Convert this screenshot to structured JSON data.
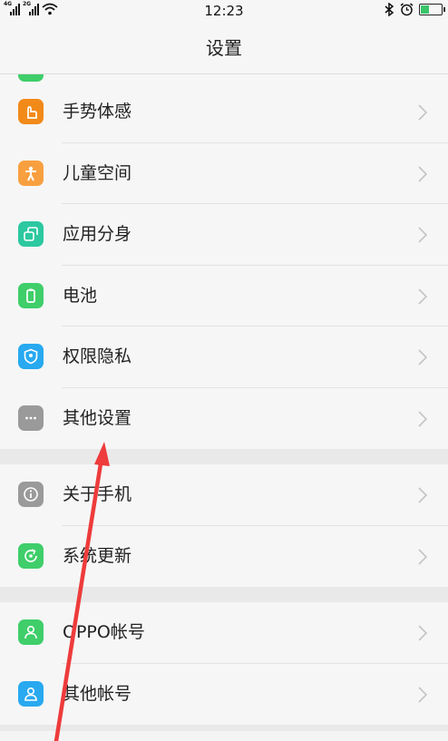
{
  "status": {
    "net1": "4G",
    "net2": "2G",
    "time": "12:23",
    "battery_level": 0.45
  },
  "header": {
    "title": "设置"
  },
  "groups": [
    [
      {
        "label": "手势体感",
        "icon": "gesture-icon",
        "color": "#f28a1a"
      },
      {
        "label": "儿童空间",
        "icon": "child-icon",
        "color": "#f8a040"
      },
      {
        "label": "应用分身",
        "icon": "app-clone-icon",
        "color": "#2cc8a0"
      },
      {
        "label": "电池",
        "icon": "battery-icon",
        "color": "#3fce6a"
      },
      {
        "label": "权限隐私",
        "icon": "shield-icon",
        "color": "#28a9f0"
      },
      {
        "label": "其他设置",
        "icon": "more-icon",
        "color": "#9a9a9a"
      }
    ],
    [
      {
        "label": "关于手机",
        "icon": "info-icon",
        "color": "#9a9a9a"
      },
      {
        "label": "系统更新",
        "icon": "update-icon",
        "color": "#3fce6a"
      }
    ],
    [
      {
        "label": "OPPO帐号",
        "icon": "account-icon",
        "color": "#3fce6a"
      },
      {
        "label": "其他帐号",
        "icon": "user-icon",
        "color": "#28a9f0"
      }
    ]
  ]
}
